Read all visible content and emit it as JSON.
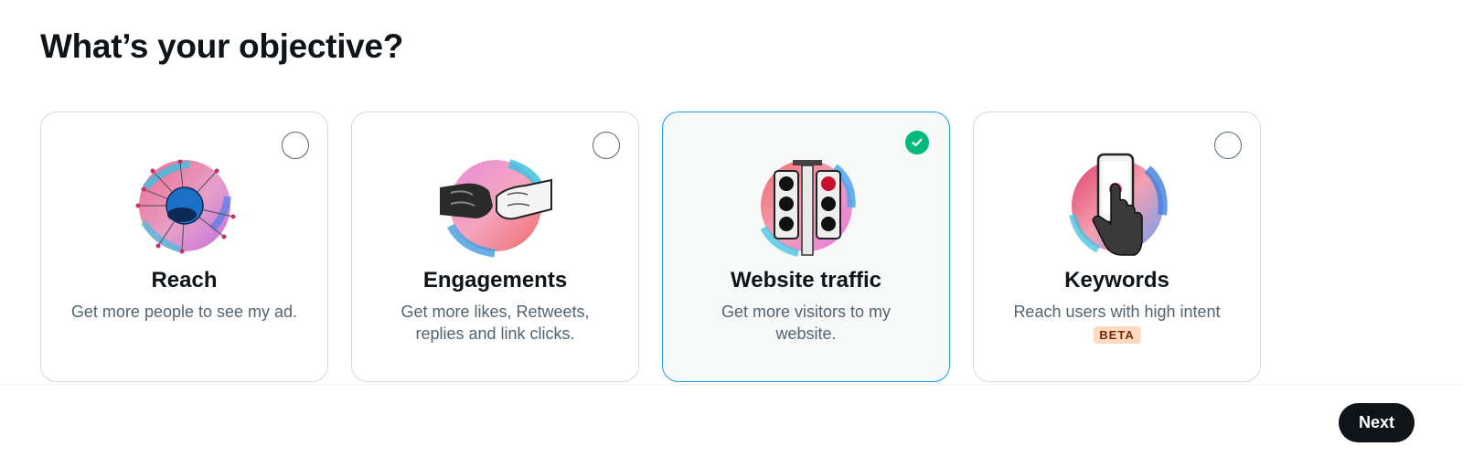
{
  "page": {
    "title": "What’s your objective?"
  },
  "objectives": [
    {
      "title": "Reach",
      "description": "Get more people to see my ad.",
      "selected": false,
      "icon": "reach-network-icon"
    },
    {
      "title": "Engagements",
      "description": "Get more likes, Retweets, replies and link clicks.",
      "selected": false,
      "icon": "fist-bump-icon"
    },
    {
      "title": "Website traffic",
      "description": "Get more visitors to my website.",
      "selected": true,
      "icon": "traffic-light-icon"
    },
    {
      "title": "Keywords",
      "description": "Reach users with high intent",
      "badge": "BETA",
      "selected": false,
      "icon": "phone-tap-icon"
    }
  ],
  "footer": {
    "next_label": "Next"
  },
  "colors": {
    "selected_border": "#1d9bf0",
    "check_green": "#00ba7c",
    "badge_bg": "#ffd9c2",
    "button_bg": "#0f1419"
  }
}
